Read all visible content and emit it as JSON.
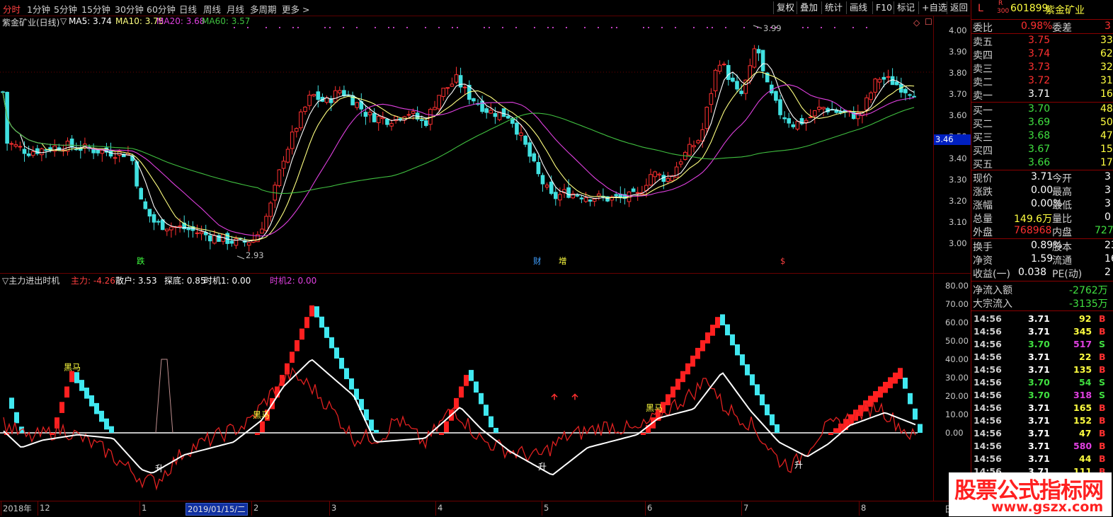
{
  "periods": [
    "分时",
    "1分钟",
    "5分钟",
    "15分钟",
    "30分钟",
    "60分钟",
    "日线",
    "周线",
    "月线",
    "多周期",
    "更多 >"
  ],
  "active_period": "分时",
  "toolbar": [
    "复权",
    "叠加",
    "统计",
    "画线",
    "F10",
    "标记",
    "+自选",
    "返回"
  ],
  "main_chart": {
    "legend": [
      {
        "text": "紫金矿业(日线)",
        "color": "#d8d8d8"
      },
      {
        "text": "▽",
        "color": "#d8d8d8"
      },
      {
        "text": "MA5: 3.74",
        "color": "#ffffff"
      },
      {
        "text": "MA10: 3.75",
        "color": "#ffff80"
      },
      {
        "text": "MA20: 3.68",
        "color": "#e040e0"
      },
      {
        "text": "MA60: 3.57",
        "color": "#40c040"
      }
    ],
    "y_ticks": [
      "4.00",
      "3.90",
      "3.80",
      "3.70",
      "3.60",
      "3.50",
      "3.40",
      "3.30",
      "3.20",
      "3.10",
      "3.00"
    ],
    "ylim": [
      2.9,
      4.05
    ],
    "current_price_tag": "3.46",
    "annotations": [
      {
        "text": "3.99",
        "color": "#c0c0c0"
      },
      {
        "text": "2.93",
        "color": "#c0c0c0"
      },
      {
        "text": "跌",
        "color": "#40ff40"
      },
      {
        "text": "财",
        "color": "#40a0ff"
      },
      {
        "text": "增",
        "color": "#ffff40"
      },
      {
        "text": "$",
        "color": "#ff4040"
      }
    ],
    "corner_marks": [
      "◇",
      "☐"
    ]
  },
  "indicator": {
    "legend": [
      {
        "text": "▽主力进出时机",
        "color": "#d8d8d8"
      },
      {
        "text": "主力: -4.26",
        "color": "#ff4040"
      },
      {
        "text": "散户: 3.53",
        "color": "#ffffff"
      },
      {
        "text": "探底: 0.85",
        "color": "#ffffff"
      },
      {
        "text": "时机1: 0.00",
        "color": "#ffffff"
      },
      {
        "text": "时机2: 0.00",
        "color": "#e040e0"
      }
    ],
    "y_ticks": [
      "80.00",
      "70.00",
      "60.00",
      "50.00",
      "40.00",
      "30.00",
      "20.00",
      "10.00",
      "0.00"
    ],
    "ylim": [
      -30,
      80
    ],
    "labels": [
      {
        "text": "黑马",
        "color": "#ffff40"
      },
      {
        "text": "黑马",
        "color": "#ffff40"
      },
      {
        "text": "黑马",
        "color": "#ffff40"
      },
      {
        "text": "升",
        "color": "#ffffff"
      },
      {
        "text": "升",
        "color": "#ffffff"
      },
      {
        "text": "升",
        "color": "#ffffff"
      }
    ]
  },
  "x_axis": {
    "labels": [
      "2018年",
      "12",
      "1",
      "2019/01/15/二",
      "2",
      "3",
      "4",
      "5",
      "6",
      "7",
      "8"
    ],
    "right_label": "日"
  },
  "quote": {
    "header": {
      "flag": "L",
      "r": "R",
      "num": "300",
      "code": "601899",
      "name": "紫金矿业"
    },
    "weibi": {
      "label": "委比",
      "value": "0.98%",
      "label2": "委差",
      "value2": "3"
    },
    "asks": [
      {
        "label": "卖五",
        "price": "3.75",
        "vol": "33"
      },
      {
        "label": "卖四",
        "price": "3.74",
        "vol": "62"
      },
      {
        "label": "卖三",
        "price": "3.73",
        "vol": "32"
      },
      {
        "label": "卖二",
        "price": "3.72",
        "vol": "31"
      },
      {
        "label": "卖一",
        "price": "3.71",
        "vol": "16"
      }
    ],
    "bids": [
      {
        "label": "买一",
        "price": "3.70",
        "vol": "48"
      },
      {
        "label": "买二",
        "price": "3.69",
        "vol": "50"
      },
      {
        "label": "买三",
        "price": "3.68",
        "vol": "47"
      },
      {
        "label": "买四",
        "price": "3.67",
        "vol": "15"
      },
      {
        "label": "买五",
        "price": "3.66",
        "vol": "17"
      }
    ],
    "stats": [
      {
        "l1": "现价",
        "v1": "3.71",
        "l2": "今开",
        "v2": "3"
      },
      {
        "l1": "涨跌",
        "v1": "0.00",
        "l2": "最高",
        "v2": "3"
      },
      {
        "l1": "涨幅",
        "v1": "0.00%",
        "l2": "最低",
        "v2": "3"
      },
      {
        "l1": "总量",
        "v1": "149.6万",
        "l2": "量比",
        "v2": "0"
      },
      {
        "l1": "外盘",
        "v1": "768968",
        "l2": "内盘",
        "v2": "727"
      }
    ],
    "stats2": [
      {
        "l1": "换手",
        "v1": "0.89%",
        "l2": "股本",
        "v2": "23"
      },
      {
        "l1": "净资",
        "v1": "1.59",
        "l2": "流通",
        "v2": "16"
      },
      {
        "l1": "收益(一)",
        "v1": "0.038",
        "l2": "PE(动)",
        "v2": "2"
      }
    ],
    "flows": [
      {
        "label": "净流入额",
        "value": "-2762万"
      },
      {
        "label": "大宗流入",
        "value": "-3135万"
      }
    ],
    "ticks": [
      {
        "t": "14:56",
        "p": "3.71",
        "v": "92",
        "s": "B"
      },
      {
        "t": "14:56",
        "p": "3.71",
        "v": "345",
        "s": "B"
      },
      {
        "t": "14:56",
        "p": "3.70",
        "v": "517",
        "s": "S"
      },
      {
        "t": "14:56",
        "p": "3.71",
        "v": "22",
        "s": "B"
      },
      {
        "t": "14:56",
        "p": "3.71",
        "v": "135",
        "s": "B"
      },
      {
        "t": "14:56",
        "p": "3.70",
        "v": "54",
        "s": "S"
      },
      {
        "t": "14:56",
        "p": "3.70",
        "v": "318",
        "s": "S"
      },
      {
        "t": "14:56",
        "p": "3.71",
        "v": "165",
        "s": "B"
      },
      {
        "t": "14:56",
        "p": "3.71",
        "v": "152",
        "s": "B"
      },
      {
        "t": "14:56",
        "p": "3.71",
        "v": "47",
        "s": "B"
      },
      {
        "t": "14:56",
        "p": "3.71",
        "v": "580",
        "s": "B"
      },
      {
        "t": "14:56",
        "p": "3.71",
        "v": "44",
        "s": "B"
      },
      {
        "t": "14:56",
        "p": "3.71",
        "v": "111",
        "s": "B"
      }
    ]
  },
  "watermark": {
    "text": "股票公式指标网",
    "url": "www.gszx.com"
  },
  "colors": {
    "up": "#ff3030",
    "down": "#40e0e0",
    "accent": "#8a0000"
  }
}
